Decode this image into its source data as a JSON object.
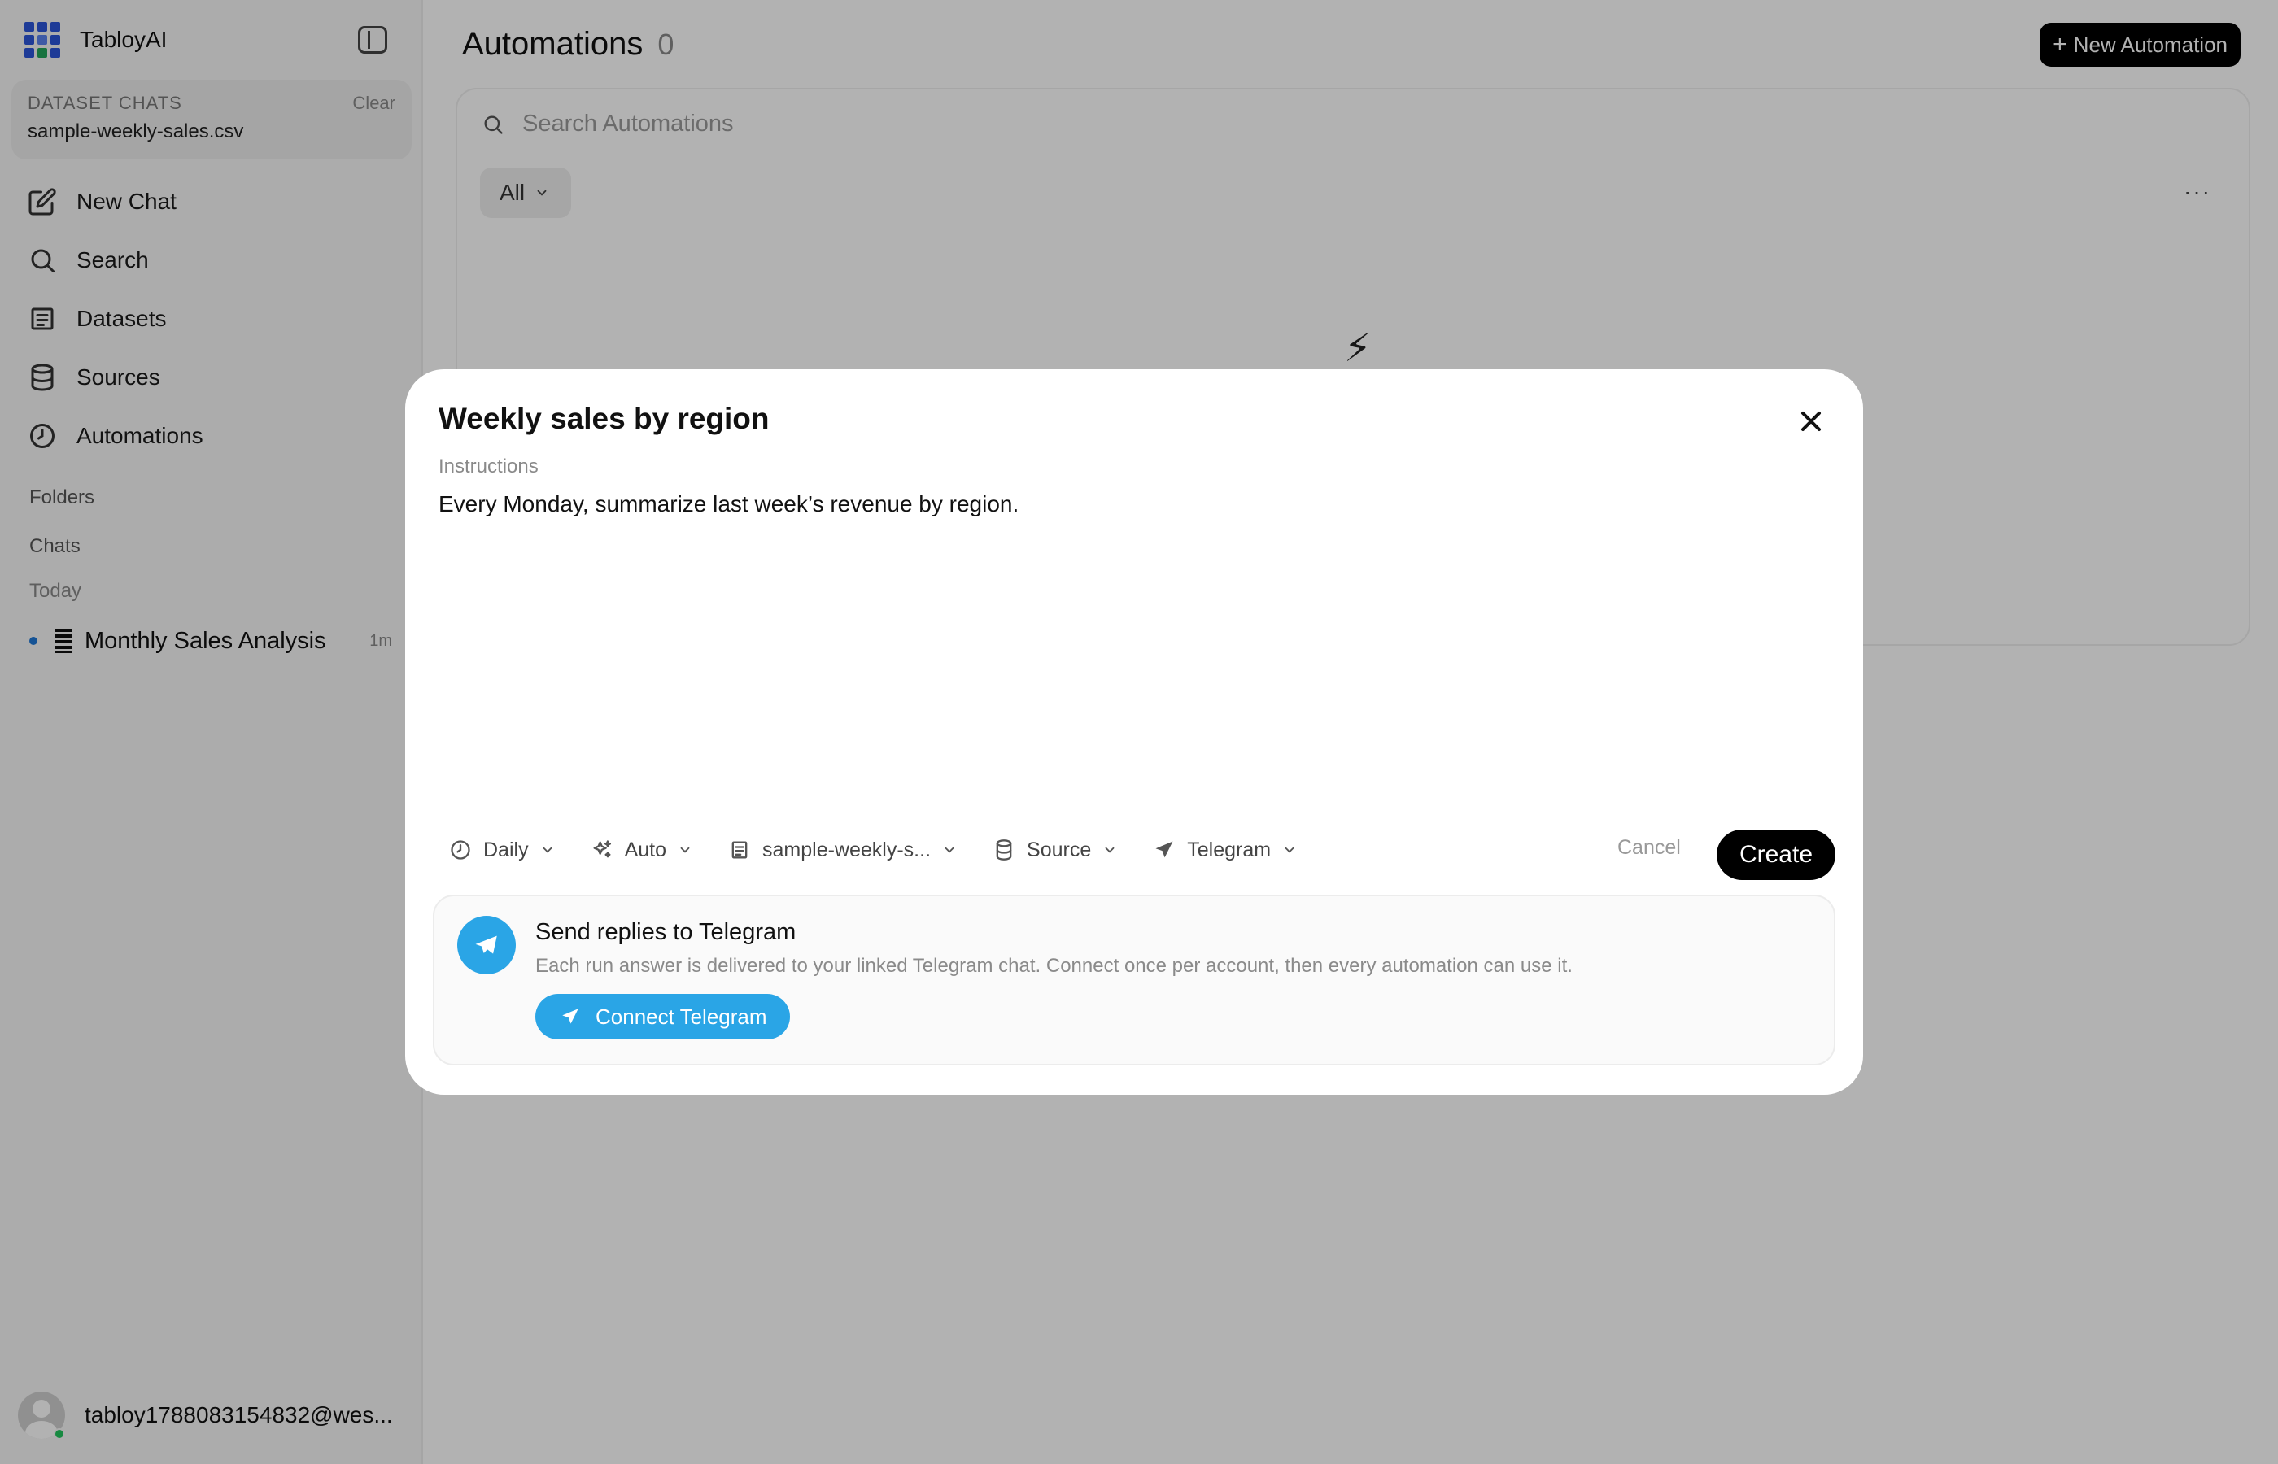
{
  "app": {
    "name": "TabloyAI"
  },
  "sidebar": {
    "dataset_chats": {
      "label": "DATASET CHATS",
      "clear_label": "Clear",
      "file": "sample-weekly-sales.csv"
    },
    "nav": [
      {
        "label": "New Chat",
        "icon": "edit-icon"
      },
      {
        "label": "Search",
        "icon": "search-icon"
      },
      {
        "label": "Datasets",
        "icon": "dataset-icon"
      },
      {
        "label": "Sources",
        "icon": "database-icon"
      },
      {
        "label": "Automations",
        "icon": "clock-icon"
      }
    ],
    "folders_label": "Folders",
    "chats_label": "Chats",
    "today_label": "Today",
    "chats": [
      {
        "title": "Monthly Sales Analysis",
        "time": "1m"
      }
    ],
    "user_email": "tabloy1788083154832@wes..."
  },
  "main": {
    "title": "Automations",
    "count": "0",
    "new_button_label": "New Automation",
    "search_placeholder": "Search Automations",
    "filter_label": "All",
    "more_label": "···"
  },
  "modal": {
    "title": "Weekly sales by region",
    "instructions_label": "Instructions",
    "instructions_text": "Every Monday, summarize last week’s revenue by region.",
    "toolbar": {
      "schedule": "Daily",
      "model": "Auto",
      "dataset": "sample-weekly-s...",
      "source": "Source",
      "channel": "Telegram"
    },
    "cancel_label": "Cancel",
    "create_label": "Create",
    "telegram": {
      "title": "Send replies to Telegram",
      "description": "Each run answer is delivered to your linked Telegram chat. Connect once per account, then every automation can use it.",
      "connect_label": "Connect Telegram"
    }
  },
  "colors": {
    "accent": "#000000",
    "telegram": "#2aa5e6",
    "brand": "#2b55d9",
    "online": "#22c55e"
  }
}
